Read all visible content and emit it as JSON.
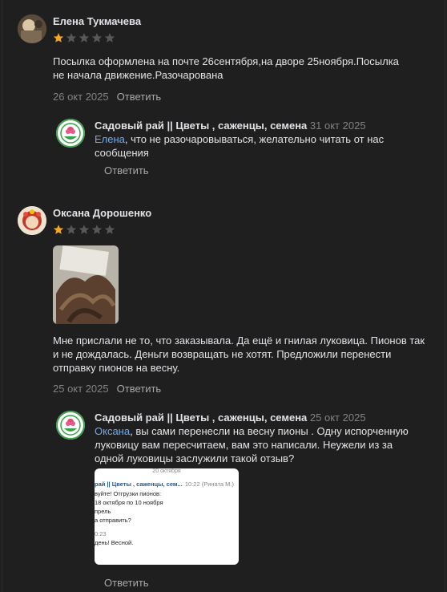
{
  "comments": [
    {
      "author": "Елена Тукмачева",
      "rating": 1,
      "text": "Посылка оформлена на почте 26сентября,на дворе 25ноября.Посылка не начала движение.Разочарована",
      "date": "26 окт 2025",
      "reply_label": "Ответить",
      "answer": {
        "group": "Садовый рай || Цветы , саженцы, семена",
        "date": "31 окт 2025",
        "mention": "Елена",
        "text": ", что не разочаровываться, желательно читать от нас сообщения",
        "reply_label": "Ответить"
      }
    },
    {
      "author": "Оксана Дорошенко",
      "rating": 1,
      "text": "Мне прислали не то, что заказывала. Да ещё и гнилая луковица. Пионов так и не дождалась. Деньги возвращать не хотят. Предложили перенести отправку пионов на весну.",
      "date": "25 окт 2025",
      "reply_label": "Ответить",
      "answer": {
        "group": "Садовый рай || Цветы , саженцы, семена",
        "date": "25 окт 2025",
        "mention": "Оксана",
        "text": ", вы сами перенесли на весну пионы . Одну испорченную луковицу вам пересчитаем, вам это написали. Неужели из за одной луковицы заслужили такой отзыв?",
        "reply_label": "Ответить",
        "screenshot": {
          "header": "20 октября",
          "sender": "рай || Цветы , саженцы, сем...",
          "time": "10:22 (Рината М.)",
          "line1": "вуйте! Отгрузки пионов:",
          "line2": "18 октября по 10 ноября",
          "line3": "прель",
          "line4": "а отправить?",
          "time2": "0:23",
          "line5": "день! Весной."
        }
      }
    }
  ],
  "colors": {
    "star_filled": "#f5a623",
    "star_empty": "#555759",
    "mention": "#71aaeb",
    "background": "#1f1f20"
  }
}
